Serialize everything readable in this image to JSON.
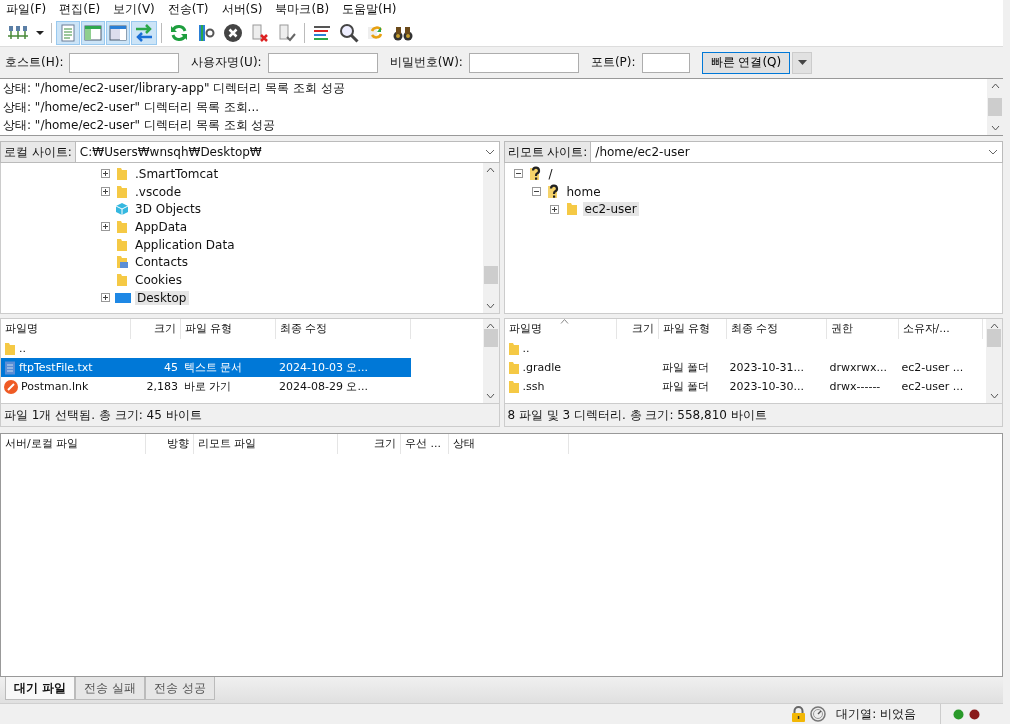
{
  "menu": [
    "파일(F)",
    "편집(E)",
    "보기(V)",
    "전송(T)",
    "서버(S)",
    "북마크(B)",
    "도움말(H)"
  ],
  "toolbar": {
    "view_toggles": [
      {
        "selected": true
      },
      {
        "selected": true
      },
      {
        "selected": true
      },
      {
        "selected": true
      }
    ]
  },
  "quickconnect": {
    "host_label": "호스트(H):",
    "user_label": "사용자명(U):",
    "password_label": "비밀번호(W):",
    "port_label": "포트(P):",
    "button": "빠른 연결(Q)"
  },
  "log": [
    "상태: \"/home/ec2-user/library-app\" 디렉터리 목록 조회 성공",
    "상태: \"/home/ec2-user\" 디렉터리 목록 조회...",
    "상태: \"/home/ec2-user\" 디렉터리 목록 조회 성공"
  ],
  "local": {
    "label": "로컬 사이트:",
    "path": "C:₩Users₩wnsqh₩Desktop₩",
    "tree": [
      {
        "name": ".SmartTomcat",
        "kind": "folder",
        "expandable": true,
        "selected": false
      },
      {
        "name": ".vscode",
        "kind": "folder",
        "expandable": true,
        "selected": false
      },
      {
        "name": "3D Objects",
        "kind": "cube",
        "expandable": false,
        "selected": false
      },
      {
        "name": "AppData",
        "kind": "folder",
        "expandable": true,
        "selected": false
      },
      {
        "name": "Application Data",
        "kind": "folder",
        "expandable": false,
        "selected": false
      },
      {
        "name": "Contacts",
        "kind": "contacts",
        "expandable": false,
        "selected": false
      },
      {
        "name": "Cookies",
        "kind": "folder",
        "expandable": false,
        "selected": false
      },
      {
        "name": "Desktop",
        "kind": "desktop",
        "expandable": true,
        "selected": true
      }
    ],
    "columns": [
      "파일명",
      "크기",
      "파일 유형",
      "최종 수정"
    ],
    "rows": [
      {
        "kind": "folder",
        "selected": false,
        "cells": [
          "..",
          "",
          "",
          ""
        ]
      },
      {
        "kind": "text",
        "selected": true,
        "cells": [
          "ftpTestFile.txt",
          "45",
          "텍스트 문서",
          "2024-10-03 오..."
        ]
      },
      {
        "kind": "app",
        "selected": false,
        "cells": [
          "Postman.lnk",
          "2,183",
          "바로 가기",
          "2024-08-29 오..."
        ]
      }
    ],
    "status": "파일 1개 선택됨. 총 크기: 45 바이트"
  },
  "remote": {
    "label": "리모트 사이트:",
    "path": "/home/ec2-user",
    "tree": [
      {
        "name": "/",
        "kind": "unknown",
        "expanded": true,
        "selected": false,
        "children": [
          {
            "name": "home",
            "kind": "unknown",
            "expanded": true,
            "selected": false,
            "children": [
              {
                "name": "ec2-user",
                "kind": "folder",
                "expanded": false,
                "selected": true
              }
            ]
          }
        ]
      }
    ],
    "columns": [
      {
        "label": "파일명",
        "sorted": true
      },
      {
        "label": "크기",
        "sorted": false
      },
      {
        "label": "파일 유형",
        "sorted": false
      },
      {
        "label": "최종 수정",
        "sorted": false
      },
      {
        "label": "권한",
        "sorted": false
      },
      {
        "label": "소유자/...",
        "sorted": false
      }
    ],
    "rows": [
      {
        "kind": "folder",
        "selected": false,
        "cells": [
          "..",
          "",
          "",
          "",
          "",
          ""
        ]
      },
      {
        "kind": "folder",
        "selected": false,
        "cells": [
          ".gradle",
          "",
          "파일 폴더",
          "2023-10-31...",
          "drwxrwx...",
          "ec2-user ..."
        ]
      },
      {
        "kind": "folder",
        "selected": false,
        "cells": [
          ".ssh",
          "",
          "파일 폴더",
          "2023-10-30...",
          "drwx------",
          "ec2-user ..."
        ]
      }
    ],
    "status": "8 파일 및 3 디렉터리. 총 크기: 558,810 바이트"
  },
  "queue": {
    "columns": [
      "서버/로컬 파일",
      "방향",
      "리모트 파일",
      "크기",
      "우선 ...",
      "상태"
    ]
  },
  "queue_tabs": [
    {
      "label": "대기 파일",
      "selected": true
    },
    {
      "label": "전송 실패",
      "selected": false
    },
    {
      "label": "전송 성공",
      "selected": false
    }
  ],
  "status_bar": {
    "queue": "대기열: 비었음"
  }
}
